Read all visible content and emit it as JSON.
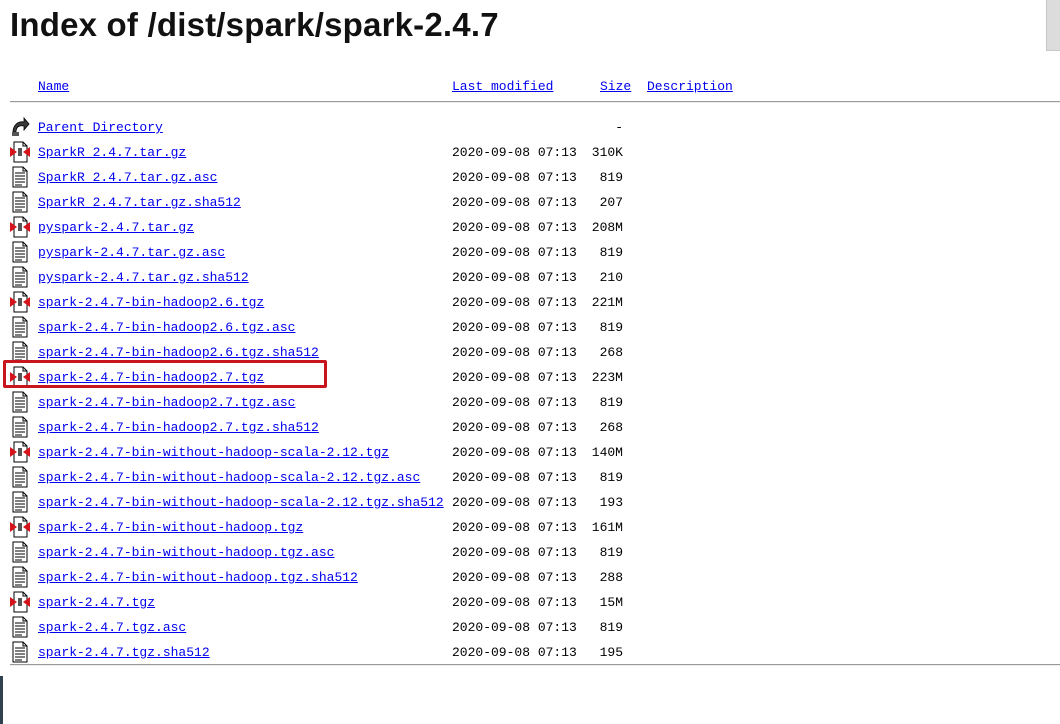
{
  "page": {
    "title": "Index of /dist/spark/spark-2.4.7"
  },
  "columns": {
    "name": "Name",
    "last_modified": "Last modified",
    "size": "Size",
    "description": "Description"
  },
  "parent": {
    "name": "Parent Directory",
    "size": "-",
    "icon": "back-arrow-icon"
  },
  "rows": [
    {
      "name": "SparkR_2.4.7.tar.gz",
      "modified": "2020-09-08 07:13",
      "size": "310K",
      "icon": "archive"
    },
    {
      "name": "SparkR_2.4.7.tar.gz.asc",
      "modified": "2020-09-08 07:13",
      "size": "819",
      "icon": "text"
    },
    {
      "name": "SparkR_2.4.7.tar.gz.sha512",
      "modified": "2020-09-08 07:13",
      "size": "207",
      "icon": "text"
    },
    {
      "name": "pyspark-2.4.7.tar.gz",
      "modified": "2020-09-08 07:13",
      "size": "208M",
      "icon": "archive"
    },
    {
      "name": "pyspark-2.4.7.tar.gz.asc",
      "modified": "2020-09-08 07:13",
      "size": "819",
      "icon": "text"
    },
    {
      "name": "pyspark-2.4.7.tar.gz.sha512",
      "modified": "2020-09-08 07:13",
      "size": "210",
      "icon": "text"
    },
    {
      "name": "spark-2.4.7-bin-hadoop2.6.tgz",
      "modified": "2020-09-08 07:13",
      "size": "221M",
      "icon": "archive"
    },
    {
      "name": "spark-2.4.7-bin-hadoop2.6.tgz.asc",
      "modified": "2020-09-08 07:13",
      "size": "819",
      "icon": "text"
    },
    {
      "name": "spark-2.4.7-bin-hadoop2.6.tgz.sha512",
      "modified": "2020-09-08 07:13",
      "size": "268",
      "icon": "text"
    },
    {
      "name": "spark-2.4.7-bin-hadoop2.7.tgz",
      "modified": "2020-09-08 07:13",
      "size": "223M",
      "icon": "archive",
      "highlighted": true
    },
    {
      "name": "spark-2.4.7-bin-hadoop2.7.tgz.asc",
      "modified": "2020-09-08 07:13",
      "size": "819",
      "icon": "text"
    },
    {
      "name": "spark-2.4.7-bin-hadoop2.7.tgz.sha512",
      "modified": "2020-09-08 07:13",
      "size": "268",
      "icon": "text"
    },
    {
      "name": "spark-2.4.7-bin-without-hadoop-scala-2.12.tgz",
      "modified": "2020-09-08 07:13",
      "size": "140M",
      "icon": "archive"
    },
    {
      "name": "spark-2.4.7-bin-without-hadoop-scala-2.12.tgz.asc",
      "modified": "2020-09-08 07:13",
      "size": "819",
      "icon": "text"
    },
    {
      "name": "spark-2.4.7-bin-without-hadoop-scala-2.12.tgz.sha512",
      "modified": "2020-09-08 07:13",
      "size": "193",
      "icon": "text"
    },
    {
      "name": "spark-2.4.7-bin-without-hadoop.tgz",
      "modified": "2020-09-08 07:13",
      "size": "161M",
      "icon": "archive"
    },
    {
      "name": "spark-2.4.7-bin-without-hadoop.tgz.asc",
      "modified": "2020-09-08 07:13",
      "size": "819",
      "icon": "text"
    },
    {
      "name": "spark-2.4.7-bin-without-hadoop.tgz.sha512",
      "modified": "2020-09-08 07:13",
      "size": "288",
      "icon": "text"
    },
    {
      "name": "spark-2.4.7.tgz",
      "modified": "2020-09-08 07:13",
      "size": "15M",
      "icon": "archive"
    },
    {
      "name": "spark-2.4.7.tgz.asc",
      "modified": "2020-09-08 07:13",
      "size": "819",
      "icon": "text"
    },
    {
      "name": "spark-2.4.7.tgz.sha512",
      "modified": "2020-09-08 07:13",
      "size": "195",
      "icon": "text"
    }
  ],
  "colors": {
    "link": "#0000ee",
    "highlight_border": "#c7161d",
    "archive_icon_red": "#d4141a"
  }
}
